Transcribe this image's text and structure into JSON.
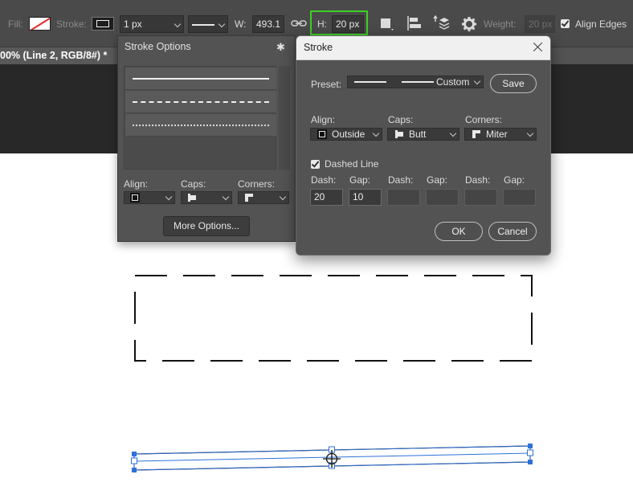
{
  "options_bar": {
    "fill_label": "Fill:",
    "stroke_label": "Stroke:",
    "stroke_width": "1 px",
    "w_label": "W:",
    "w_value": "493.1",
    "h_label": "H:",
    "h_value": "20 px",
    "weight_label": "Weight:",
    "weight_value": "20 px",
    "align_edges_label": "Align Edges",
    "align_edges_checked": true,
    "highlight_color": "#3ecf26"
  },
  "document": {
    "tab_title": "00% (Line 2, RGB/8#) *"
  },
  "stroke_options_panel": {
    "title": "Stroke Options",
    "presets": [
      "solid",
      "dashed",
      "dotted"
    ],
    "align_label": "Align:",
    "caps_label": "Caps:",
    "corners_label": "Corners:",
    "more_options_label": "More Options..."
  },
  "stroke_dialog": {
    "title": "Stroke",
    "preset_label": "Preset:",
    "preset_value": "Custom",
    "save_label": "Save",
    "align_label": "Align:",
    "align_value": "Outside",
    "caps_label": "Caps:",
    "caps_value": "Butt",
    "corners_label": "Corners:",
    "corners_value": "Miter",
    "dashed_line_label": "Dashed Line",
    "dashed_line_checked": true,
    "dash_label": "Dash:",
    "gap_label": "Gap:",
    "dash_values": [
      "20",
      "10",
      "",
      "",
      "",
      ""
    ],
    "ok_label": "OK",
    "cancel_label": "Cancel"
  }
}
